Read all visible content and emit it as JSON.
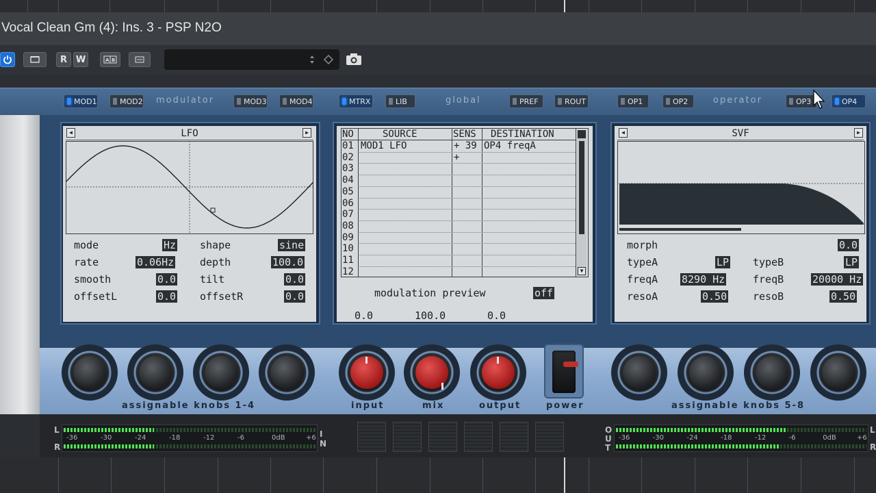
{
  "window": {
    "title": "Vocal Clean Gm (4): Ins. 3 - PSP N2O"
  },
  "toolbar": {
    "buttons": [
      "R",
      "W"
    ],
    "icons": [
      "power-icon",
      "bypass-icon",
      "ab-compare-icon",
      "menu-icon",
      "camera-icon"
    ]
  },
  "tabs": {
    "modulator_label": "modulator",
    "global_label": "global",
    "operator_label": "operator",
    "mod1": "MOD1",
    "mod2": "MOD2",
    "mod3": "MOD3",
    "mod4": "MOD4",
    "mtrx": "MTRX",
    "lib": "LIB",
    "pref": "PREF",
    "rout": "ROUT",
    "op1": "OP1",
    "op2": "OP2",
    "op3": "OP3",
    "op4": "OP4"
  },
  "lfo": {
    "title": "LFO",
    "params": {
      "mode_label": "mode",
      "mode_value": "Hz",
      "shape_label": "shape",
      "shape_value": "sine",
      "rate_label": "rate",
      "rate_value": "0.06Hz",
      "depth_label": "depth",
      "depth_value": "100.0",
      "smooth_label": "smooth",
      "smooth_value": "0.0",
      "tilt_label": "tilt",
      "tilt_value": "0.0",
      "offsetL_label": "offsetL",
      "offsetL_value": "0.0",
      "offsetR_label": "offsetR",
      "offsetR_value": "0.0"
    }
  },
  "matrix": {
    "headers": {
      "no": "NO",
      "source": "SOURCE",
      "sens": "SENS",
      "destination": "DESTINATION"
    },
    "rows": [
      {
        "no": "01",
        "source": "MOD1 LFO",
        "sens": "+ 39",
        "destination": "OP4 freqA"
      },
      {
        "no": "02",
        "source": "",
        "sens": "+",
        "destination": ""
      },
      {
        "no": "03",
        "source": "",
        "sens": "",
        "destination": ""
      },
      {
        "no": "04",
        "source": "",
        "sens": "",
        "destination": ""
      },
      {
        "no": "05",
        "source": "",
        "sens": "",
        "destination": ""
      },
      {
        "no": "06",
        "source": "",
        "sens": "",
        "destination": ""
      },
      {
        "no": "07",
        "source": "",
        "sens": "",
        "destination": ""
      },
      {
        "no": "08",
        "source": "",
        "sens": "",
        "destination": ""
      },
      {
        "no": "09",
        "source": "",
        "sens": "",
        "destination": ""
      },
      {
        "no": "10",
        "source": "",
        "sens": "",
        "destination": ""
      },
      {
        "no": "11",
        "source": "",
        "sens": "",
        "destination": ""
      },
      {
        "no": "12",
        "source": "",
        "sens": "",
        "destination": ""
      }
    ],
    "preview_label": "modulation preview",
    "preview_state": "off",
    "preview_values": [
      "0.0",
      "100.0",
      "0.0"
    ]
  },
  "svf": {
    "title": "SVF",
    "params": {
      "morph_label": "morph",
      "morph_value": "0.0",
      "typeA_label": "typeA",
      "typeA_value": "LP",
      "typeB_label": "typeB",
      "typeB_value": "LP",
      "freqA_label": "freqA",
      "freqA_value": "8290 Hz",
      "freqB_label": "freqB",
      "freqB_value": "20000 Hz",
      "resoA_label": "resoA",
      "resoA_value": "0.50",
      "resoB_label": "resoB",
      "resoB_value": "0.50"
    }
  },
  "knobs": {
    "assign_1_4_label": "assignable knobs 1-4",
    "input_label": "input",
    "mix_label": "mix",
    "output_label": "output",
    "power_label": "power",
    "assign_5_8_label": "assignable knobs 5-8"
  },
  "meters": {
    "left": {
      "row1": "L",
      "row2": "R",
      "side1": "I",
      "side2": "N",
      "scale": [
        "-36",
        "-30",
        "-24",
        "-18",
        "-12",
        "-6",
        "0dB",
        "+6"
      ],
      "level_L": 0.36,
      "level_R": 0.36
    },
    "right": {
      "row0": "O",
      "row1": "U",
      "row2": "T",
      "side1": "L",
      "side2": "R",
      "scale": [
        "-36",
        "-30",
        "-24",
        "-18",
        "-12",
        "-6",
        "0dB",
        "+6"
      ],
      "level_L": 0.68,
      "level_R": 0.65
    }
  }
}
